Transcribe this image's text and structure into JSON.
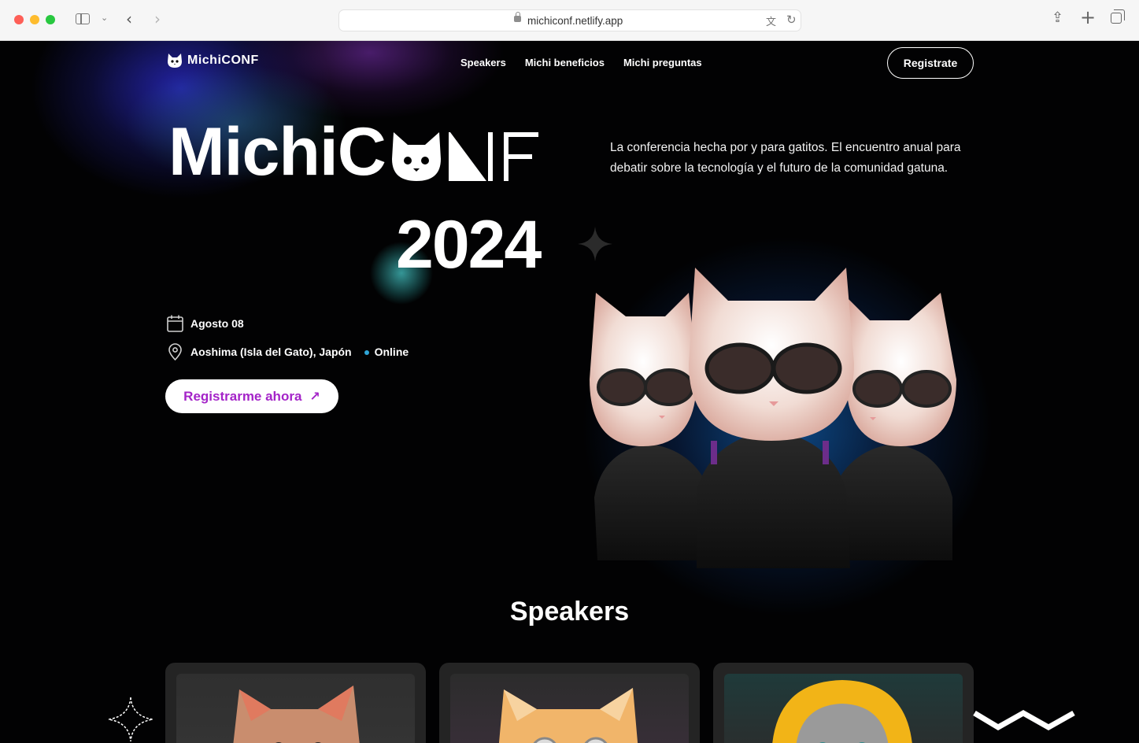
{
  "browser": {
    "url": "michiconf.netlify.app"
  },
  "nav": {
    "logo_text": "MichiCONF",
    "links": [
      "Speakers",
      "Michi beneficios",
      "Michi preguntas"
    ],
    "register_label": "Registrate"
  },
  "hero": {
    "title_prefix": "MichiC",
    "year": "2024",
    "description": "La conferencia hecha por y para gatitos. El encuentro anual para debatir sobre la tecnología y el futuro de la comunidad gatuna.",
    "date": "Agosto 08",
    "location": "Aoshima (Isla del Gato), Japón",
    "online": "Online",
    "cta_label": "Registrarme ahora",
    "cta_arrow": "↗"
  },
  "speakers": {
    "title": "Speakers"
  },
  "colors": {
    "accent": "#a424c8",
    "online_dot": "#2fa6d8",
    "background": "#020203"
  }
}
